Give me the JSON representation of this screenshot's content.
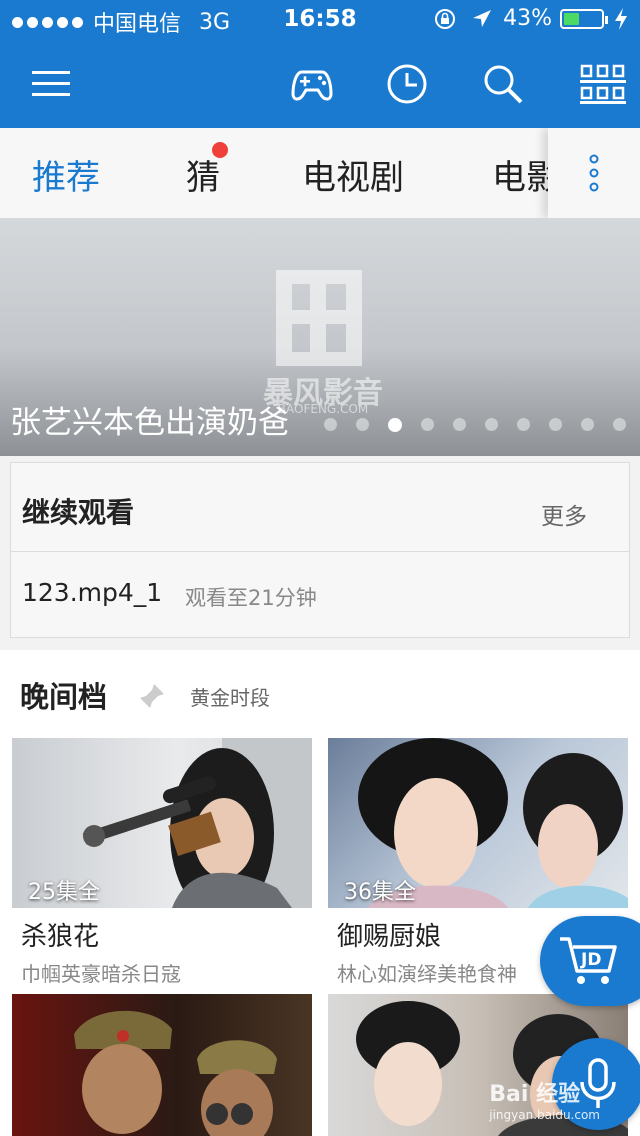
{
  "status": {
    "carrier": "中国电信",
    "network": "3G",
    "time": "16:58",
    "battery": "43%",
    "battery_level": 0.43
  },
  "toolbar": {
    "icons": [
      "menu-icon",
      "gamepad-icon",
      "history-clock-icon",
      "search-icon",
      "grid-categories-icon"
    ]
  },
  "tabs": [
    {
      "label": "推荐",
      "active": true
    },
    {
      "label": "猜",
      "badge": true
    },
    {
      "label": "电视剧"
    },
    {
      "label": "电影"
    }
  ],
  "banner": {
    "caption": "张艺兴本色出演奶爸",
    "logo_text": "暴风影音",
    "logo_sub": "BAOFENG.COM",
    "dots_total": 10,
    "dot_active_index": 2
  },
  "continue_watching": {
    "title": "继续观看",
    "more": "更多",
    "item": {
      "file": "123.mp4_1",
      "progress": "观看至21分钟"
    }
  },
  "prime_time": {
    "title": "晚间档",
    "subtitle": "黄金时段"
  },
  "cards": [
    {
      "episodes": "25集全",
      "title": "杀狼花",
      "desc": "巾帼英豪暗杀日寇"
    },
    {
      "episodes": "36集全",
      "title": "御赐厨娘",
      "desc": "林心如演绎美艳食神"
    },
    {
      "episodes": "",
      "title": "",
      "desc": ""
    },
    {
      "episodes": "",
      "title": "",
      "desc": ""
    }
  ],
  "fab": {
    "jd_label": "JD"
  },
  "watermark": {
    "text": "Bai 经验",
    "sub": "jingyan.baidu.com"
  },
  "colors": {
    "brand": "#1a7ad0",
    "badge": "#f0403a"
  }
}
